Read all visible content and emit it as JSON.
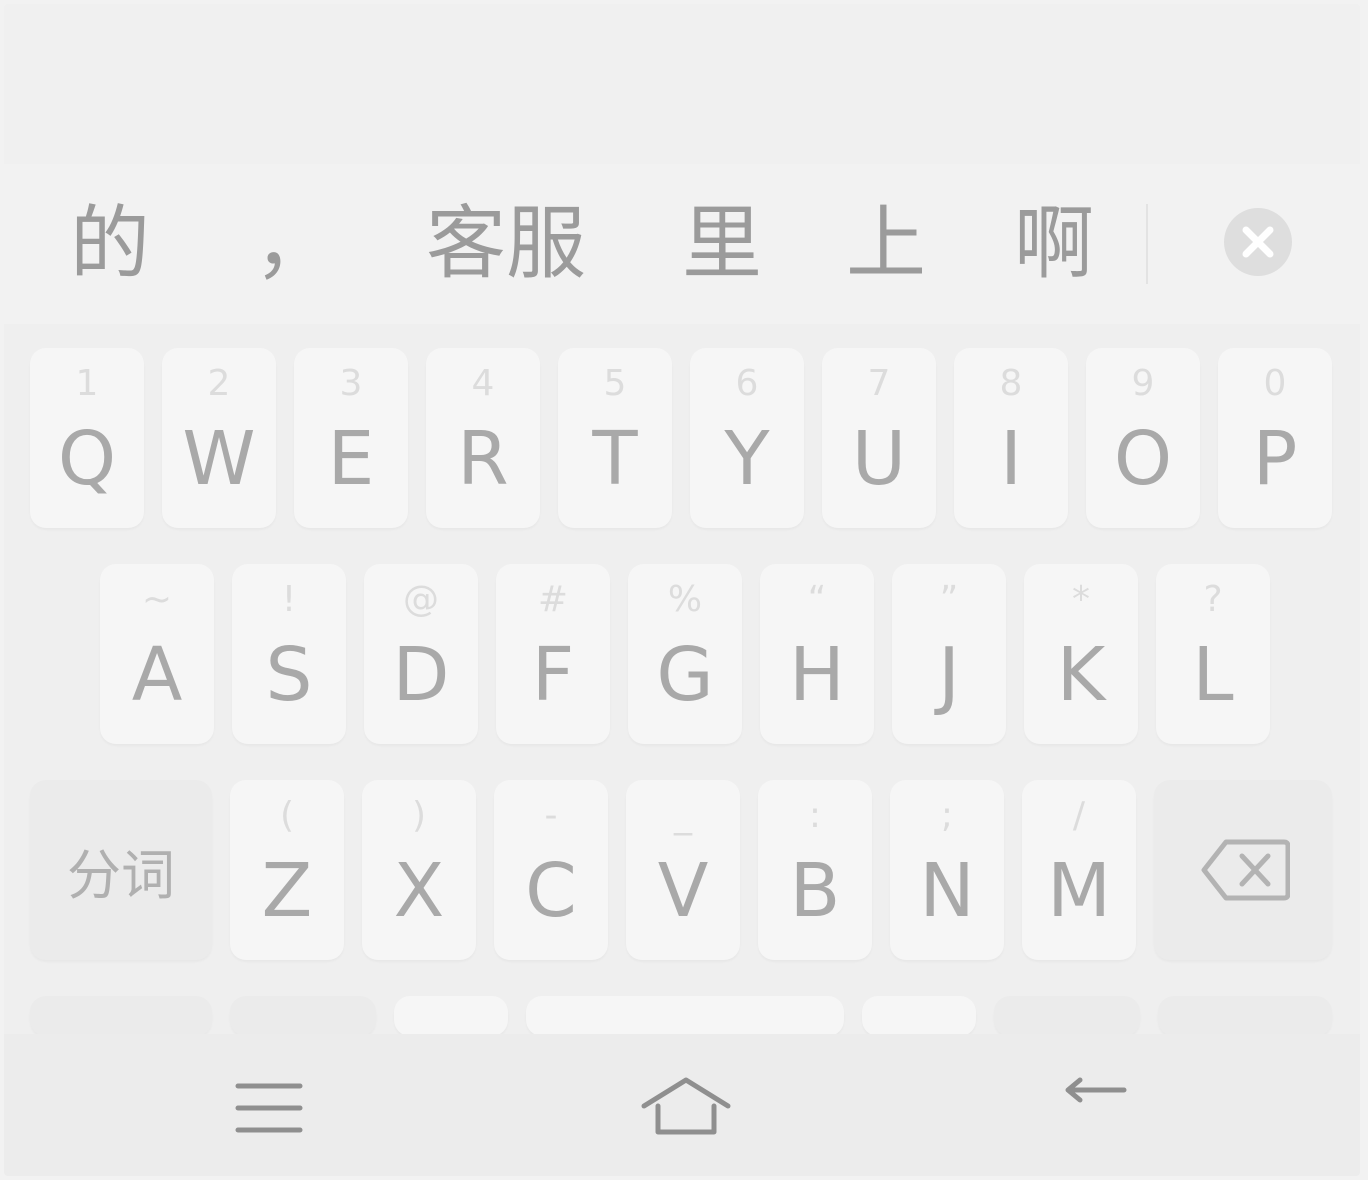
{
  "candidates": [
    "的",
    "，",
    "客服",
    "里",
    "上",
    "啊"
  ],
  "clear_icon": "close-circle-icon",
  "rows": [
    {
      "keys": [
        {
          "letter": "Q",
          "hint": "1"
        },
        {
          "letter": "W",
          "hint": "2"
        },
        {
          "letter": "E",
          "hint": "3"
        },
        {
          "letter": "R",
          "hint": "4"
        },
        {
          "letter": "T",
          "hint": "5"
        },
        {
          "letter": "Y",
          "hint": "6"
        },
        {
          "letter": "U",
          "hint": "7"
        },
        {
          "letter": "I",
          "hint": "8"
        },
        {
          "letter": "O",
          "hint": "9"
        },
        {
          "letter": "P",
          "hint": "0"
        }
      ]
    },
    {
      "keys": [
        {
          "letter": "A",
          "hint": "~"
        },
        {
          "letter": "S",
          "hint": "!"
        },
        {
          "letter": "D",
          "hint": "@"
        },
        {
          "letter": "F",
          "hint": "#"
        },
        {
          "letter": "G",
          "hint": "%"
        },
        {
          "letter": "H",
          "hint": "“"
        },
        {
          "letter": "J",
          "hint": "”"
        },
        {
          "letter": "K",
          "hint": "*"
        },
        {
          "letter": "L",
          "hint": "?"
        }
      ]
    },
    {
      "fn_left": "分词",
      "keys": [
        {
          "letter": "Z",
          "hint": "("
        },
        {
          "letter": "X",
          "hint": ")"
        },
        {
          "letter": "C",
          "hint": "-"
        },
        {
          "letter": "V",
          "hint": "_"
        },
        {
          "letter": "B",
          "hint": ":"
        },
        {
          "letter": "N",
          "hint": ";"
        },
        {
          "letter": "M",
          "hint": "/"
        }
      ],
      "fn_right_icon": "backspace-icon"
    }
  ],
  "nav": {
    "menu_icon": "menu-icon",
    "home_icon": "home-icon",
    "back_icon": "back-icon"
  },
  "colors": {
    "background": "#f0f0f0",
    "key": "#f6f6f6",
    "key_text": "#a9a9a9",
    "hint_text": "#dcdcdc",
    "candidate_text": "#9b9b9b"
  }
}
